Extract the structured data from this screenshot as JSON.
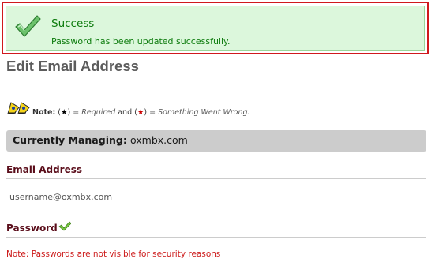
{
  "alert": {
    "title": "Success",
    "message": "Password has been updated successfully."
  },
  "page": {
    "title": "Edit Email Address"
  },
  "note": {
    "label": "Note:",
    "required_open": "(",
    "required_star": "★",
    "required_close": ")",
    "required_text": "= Required",
    "and": "and",
    "error_open": "(",
    "error_star": "★",
    "error_close": ")",
    "error_text": "= Something Went Wrong."
  },
  "managing": {
    "label": "Currently Managing:",
    "value": "oxmbx.com"
  },
  "email": {
    "label": "Email Address",
    "value": "username@oxmbx.com"
  },
  "password": {
    "label": "Password",
    "note": "Note: Passwords are not visible for security reasons"
  },
  "icons": {
    "success": "checkmark-icon",
    "note": "warning-flags-icon",
    "password_status": "checkmark-icon"
  },
  "colors": {
    "alert_border": "#d0181d",
    "alert_background": "#dcf7dc",
    "success_text": "#0b7a0b",
    "section_label": "#5a0d1a",
    "error_text": "#cc1a1a",
    "managing_background": "#cccccc"
  }
}
